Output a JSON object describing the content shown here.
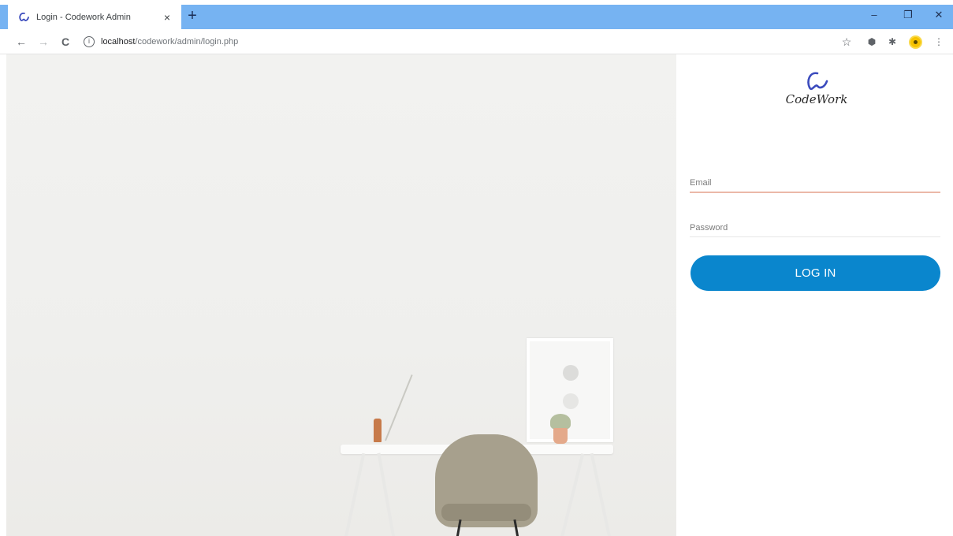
{
  "browser": {
    "tab": {
      "title": "Login - Codework Admin",
      "close_glyph": "×"
    },
    "new_tab_glyph": "+",
    "window_controls": {
      "minimize": "–",
      "restore": "❐",
      "close": "✕"
    },
    "nav": {
      "back": "←",
      "forward": "→",
      "reload": "C"
    },
    "url": {
      "host": "localhost",
      "path": "/codework/admin/login.php"
    },
    "toolbar_icons": {
      "bookmark": "☆",
      "extension": "⬢",
      "puzzle": "✱",
      "menu": "⋮"
    }
  },
  "brand": {
    "name": "CodeWork",
    "color": "#3b4bbd"
  },
  "login_form": {
    "email": {
      "placeholder": "Email",
      "value": ""
    },
    "password": {
      "placeholder": "Password",
      "value": ""
    },
    "submit_label": "LOG IN",
    "button_color": "#0a86cd"
  }
}
